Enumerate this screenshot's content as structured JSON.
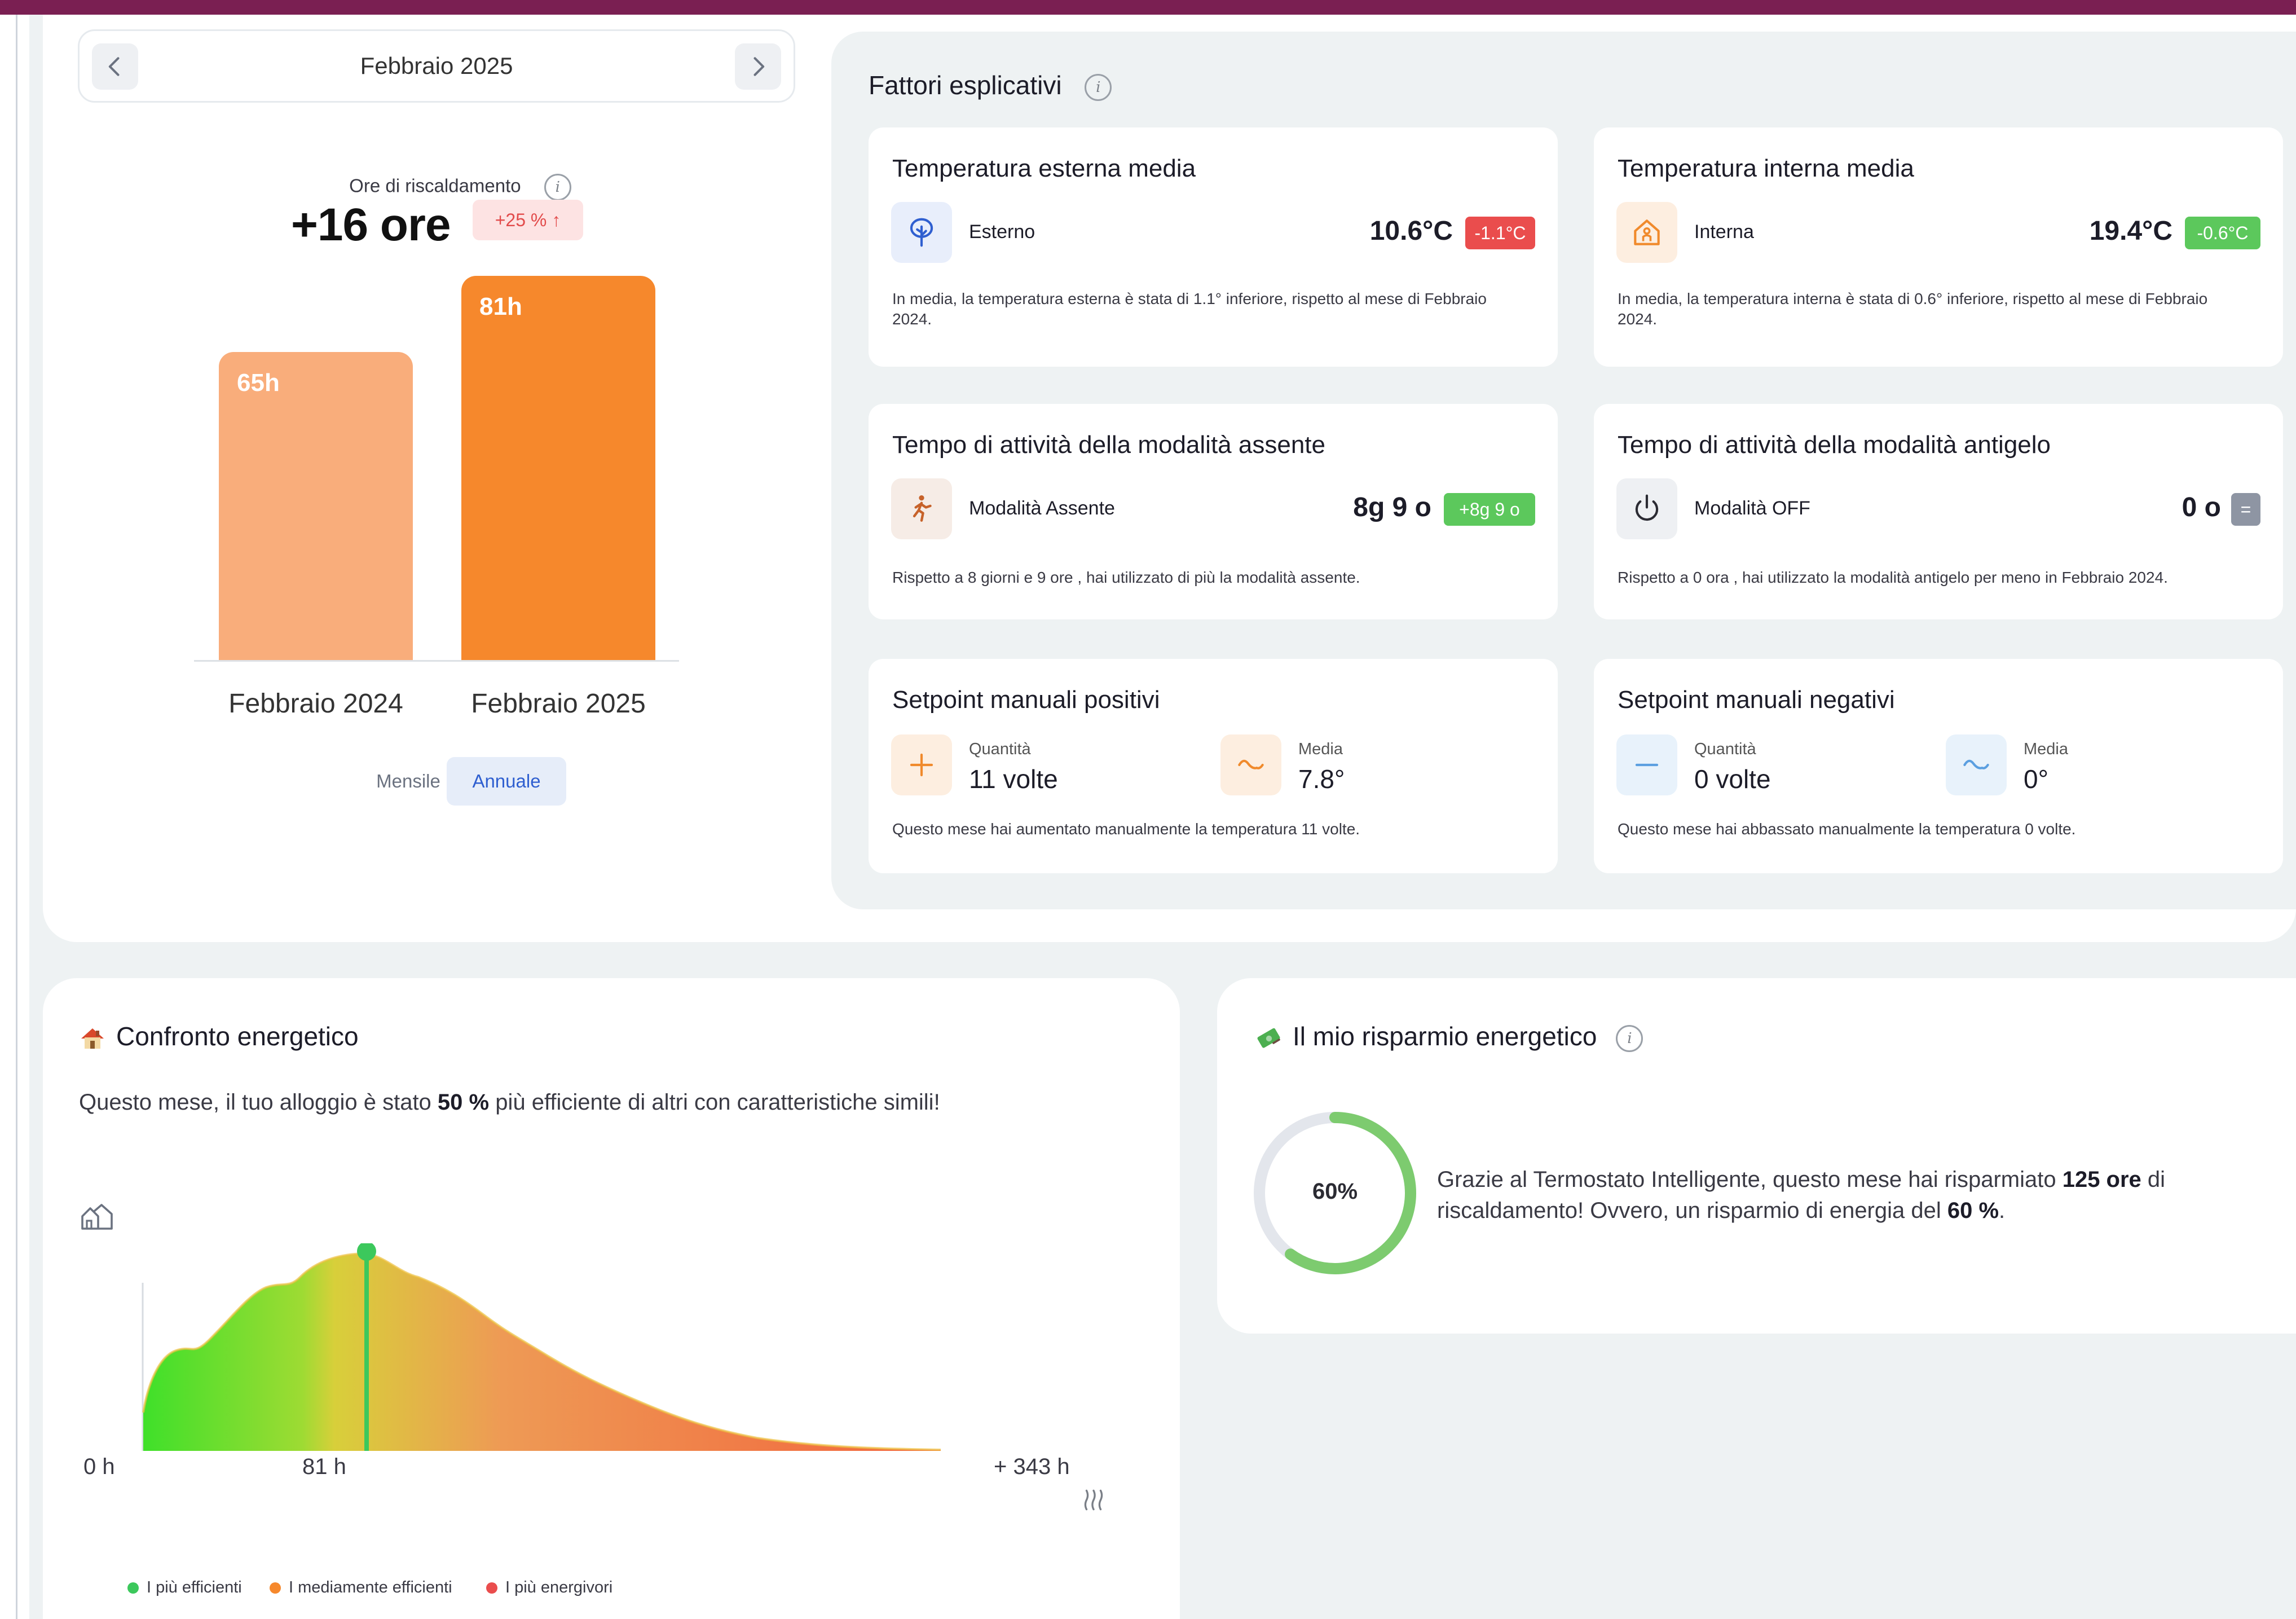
{
  "header": {
    "month": "Febbraio 2025"
  },
  "heating": {
    "caption": "Ore di riscaldamento",
    "value": "+16 ore",
    "badge": "+25 % ↑",
    "bars": [
      {
        "category": "Febbraio 2024",
        "label": "65h",
        "hours": 65,
        "color": "#f9ad7b"
      },
      {
        "category": "Febbraio 2025",
        "label": "81h",
        "hours": 81,
        "color": "#f6882c"
      }
    ],
    "toggle": {
      "monthly": "Mensile",
      "annual": "Annuale",
      "selected": "Annuale"
    }
  },
  "factors": {
    "title": "Fattori esplicativi",
    "cards": [
      {
        "title": "Temperatura esterna media",
        "label": "Esterno",
        "value": "10.6°C",
        "badge": "-1.1°C",
        "badge_color": "#ea4d4d",
        "icon": "tree-icon",
        "desc": "In media, la temperatura esterna è stata di 1.1° inferiore, rispetto al mese di Febbraio 2024."
      },
      {
        "title": "Temperatura interna media",
        "label": "Interna",
        "value": "19.4°C",
        "badge": "-0.6°C",
        "badge_color": "#5cc85c",
        "icon": "house-person-icon",
        "desc": "In media, la temperatura interna è stata di 0.6° inferiore, rispetto al mese di Febbraio 2024."
      },
      {
        "title": "Tempo di attività della modalità assente",
        "label": "Modalità Assente",
        "value": "8g 9 o",
        "badge": "+8g 9 o",
        "badge_color": "#5cc85c",
        "icon": "walking-person-icon",
        "desc": "Rispetto a 8 giorni e 9 ore , hai utilizzato di più la modalità assente."
      },
      {
        "title": "Tempo di attività della modalità antigelo",
        "label": "Modalità OFF",
        "value": "0 o",
        "badge": "=",
        "badge_color": "#8e95a3",
        "icon": "power-icon",
        "desc": "Rispetto a 0 ora , hai utilizzato la modalità antigelo per meno in Febbraio 2024."
      },
      {
        "title": "Setpoint manuali positivi",
        "qty_caption": "Quantità",
        "qty_value": "11 volte",
        "avg_caption": "Media",
        "avg_value": "7.8°",
        "desc": "Questo mese hai aumentato manualmente la temperatura 11 volte."
      },
      {
        "title": "Setpoint manuali negativi",
        "qty_caption": "Quantità",
        "qty_value": "0 volte",
        "avg_caption": "Media",
        "avg_value": "0°",
        "desc": "Questo mese hai abbassato manualmente la temperatura 0 volte."
      }
    ]
  },
  "energy": {
    "title": "Confronto energetico",
    "text_before": "Questo mese, il tuo alloggio è stato ",
    "text_bold": "50 %",
    "text_after": " più efficiente di altri con caratteristiche simili!",
    "axis_min": "0 h",
    "axis_marker": "81 h",
    "axis_max": "+ 343 h",
    "legend": [
      {
        "label": "I più efficienti",
        "color": "#3cc85c"
      },
      {
        "label": "I mediamente efficienti",
        "color": "#f6882c"
      },
      {
        "label": "I più energivori",
        "color": "#ea4d4d"
      }
    ]
  },
  "savings": {
    "title": "Il mio risparmio energetico",
    "percent_label": "60%",
    "percent": 60,
    "text_before": "Grazie al Termostato Intelligente, questo mese hai risparmiato ",
    "text_bold1": "125 ore",
    "text_mid": " di riscaldamento! Ovvero, un risparmio di energia del ",
    "text_bold2": "60 %",
    "text_after": "."
  }
}
